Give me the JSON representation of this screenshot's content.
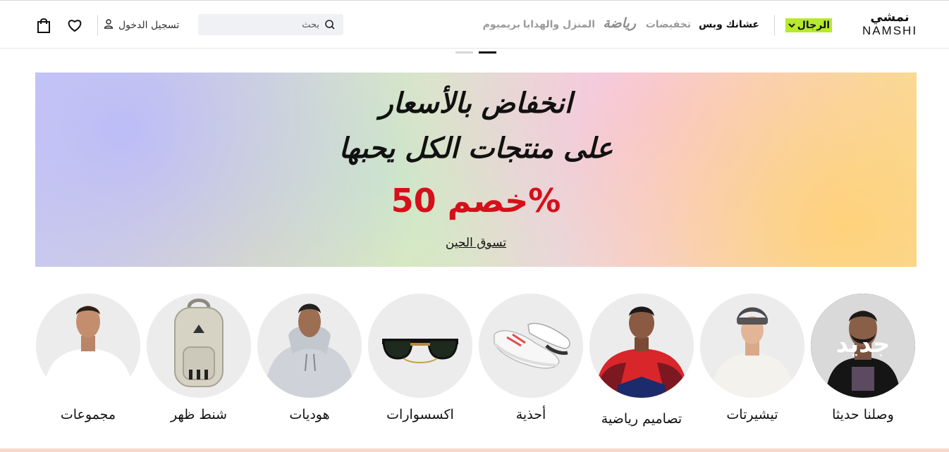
{
  "header": {
    "logo_ar": "نمشي",
    "logo_en": "NAMSHI",
    "gender_label": "الرجال",
    "nav": [
      {
        "label": "عشانك وبس",
        "state": "active"
      },
      {
        "label": "تخفيضات",
        "state": "muted"
      },
      {
        "label": "رياضة",
        "state": "muted"
      },
      {
        "label": "المنزل والهدايا",
        "state": "muted"
      },
      {
        "label": "بريميوم",
        "state": "muted"
      }
    ],
    "search_placeholder": "بحث",
    "login_label": "تسجيل الدخول",
    "icons": [
      "search-icon",
      "user-icon",
      "heart-icon",
      "bag-icon",
      "chevron-down-icon"
    ]
  },
  "slider": {
    "dots": 2,
    "active_dot": 2
  },
  "banner": {
    "line1": "انخفاض بالأسعار",
    "line2": "على منتجات الكل يحبها",
    "discount": "خصم 50%",
    "cta": "تسوق الحين"
  },
  "categories": [
    {
      "label": "وصلنا حديثا",
      "badge": "جديد"
    },
    {
      "label": "تيشيرتات"
    },
    {
      "label": "تصاميم رياضية"
    },
    {
      "label": "أحذية"
    },
    {
      "label": "اكسسوارات"
    },
    {
      "label": "هوديات"
    },
    {
      "label": "شنط ظهر"
    },
    {
      "label": "مجموعات"
    }
  ],
  "colors": {
    "accent": "#b6ea2a",
    "discount_red": "#d5101a",
    "muted_nav": "#9a9a9a",
    "search_bg": "#f0f1f4"
  }
}
